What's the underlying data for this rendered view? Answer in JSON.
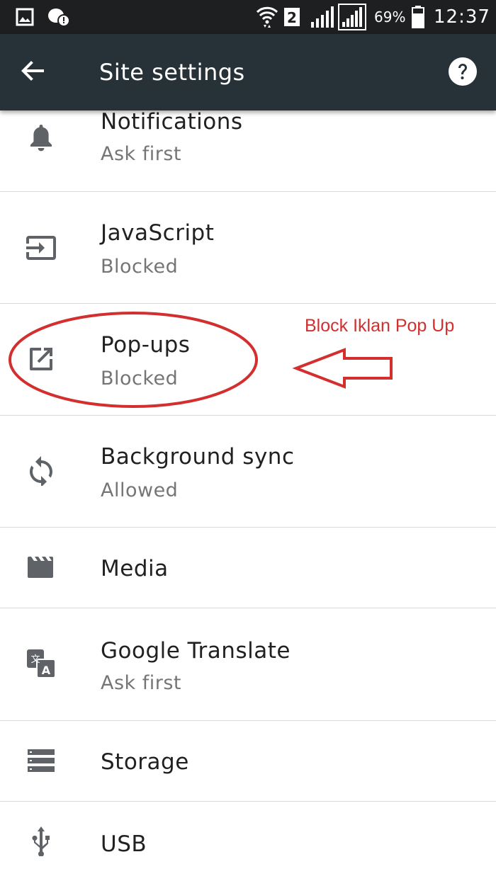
{
  "status_bar": {
    "battery_percent": "69%",
    "time": "12:37",
    "sim_slot": "2",
    "icons": [
      "gallery-icon",
      "messenger-icon",
      "wifi-icon",
      "sim-2-icon",
      "signal-1-icon",
      "signal-2-icon",
      "battery-icon"
    ]
  },
  "toolbar": {
    "title": "Site settings",
    "back_icon": "arrow-back-icon",
    "help_icon": "help-circle-icon"
  },
  "settings": [
    {
      "title": "Notifications",
      "subtitle": "Ask first",
      "icon": "bell-icon"
    },
    {
      "title": "JavaScript",
      "subtitle": "Blocked",
      "icon": "input-arrow-icon"
    },
    {
      "title": "Pop-ups",
      "subtitle": "Blocked",
      "icon": "open-in-new-icon"
    },
    {
      "title": "Background sync",
      "subtitle": "Allowed",
      "icon": "sync-icon"
    },
    {
      "title": "Media",
      "subtitle": "",
      "icon": "clapperboard-icon"
    },
    {
      "title": "Google Translate",
      "subtitle": "Ask first",
      "icon": "translate-icon"
    },
    {
      "title": "Storage",
      "subtitle": "",
      "icon": "storage-icon"
    },
    {
      "title": "USB",
      "subtitle": "",
      "icon": "usb-icon"
    }
  ],
  "annotation": {
    "text": "Block Iklan Pop Up",
    "color": "#d32f2f"
  },
  "colors": {
    "status_bar": "#1d1f20",
    "toolbar": "#263238",
    "title_text": "#212121",
    "subtitle_text": "#757575",
    "icon": "#5f6368",
    "divider": "#dadada"
  }
}
